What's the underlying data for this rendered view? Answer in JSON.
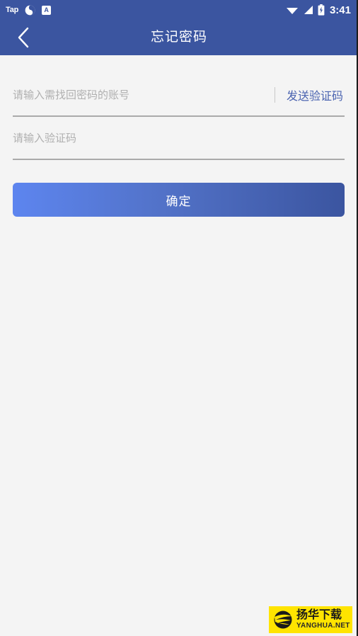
{
  "status_bar": {
    "app_tag": "Tap",
    "icons_left": [
      "swirl-icon",
      "a-badge-icon"
    ],
    "icons_right": [
      "wifi-icon",
      "signal-icon",
      "battery-charging-icon"
    ],
    "time": "3:41",
    "background_color": "#3b55a0"
  },
  "app_bar": {
    "back_label": "‹",
    "title": "忘记密码",
    "background_color": "#3b55a0"
  },
  "form": {
    "account_field": {
      "placeholder": "请输入需找回密码的账号",
      "value": ""
    },
    "send_code_label": "发送验证码",
    "send_code_color": "#4a63b0",
    "code_field": {
      "placeholder": "请输入验证码",
      "value": ""
    },
    "submit_label": "确定",
    "submit_gradient_from": "#5d85ef",
    "submit_gradient_to": "#3b55a0"
  },
  "watermark": {
    "name_cn": "扬华下载",
    "name_en": "YANGHUA.NET",
    "background_color": "#ffe400"
  },
  "page": {
    "background_color": "#f4f4f4"
  }
}
